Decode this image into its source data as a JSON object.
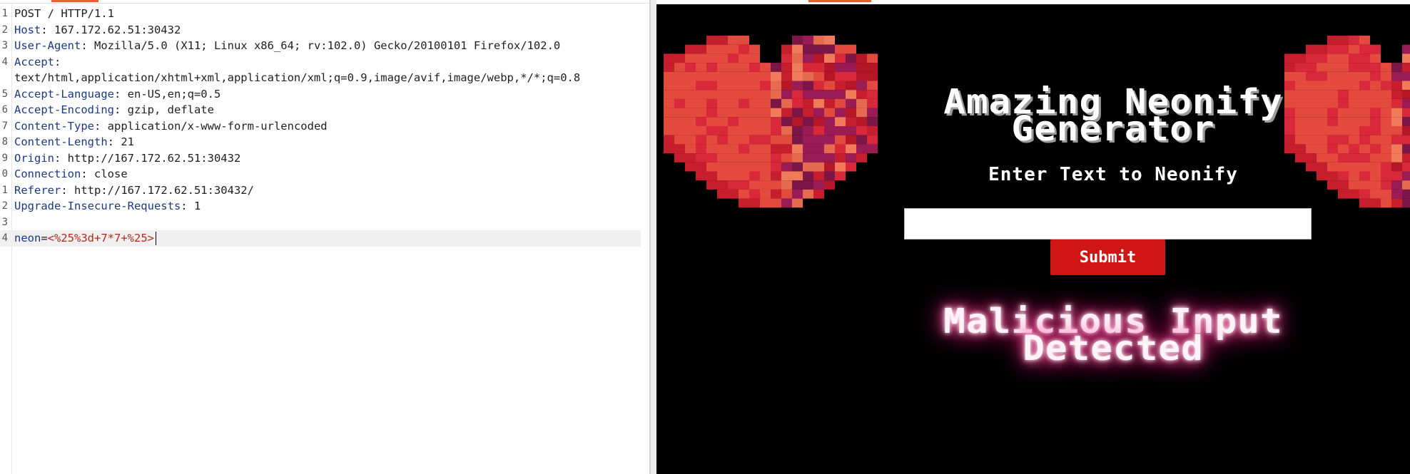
{
  "request": {
    "lines": [
      {
        "num": "1",
        "plain": "POST / HTTP/1.1"
      },
      {
        "num": "2",
        "name": "Host",
        "value": " 167.172.62.51:30432"
      },
      {
        "num": "3",
        "name": "User-Agent",
        "value": " Mozilla/5.0 (X11; Linux x86_64; rv:102.0) Gecko/20100101 Firefox/102.0"
      },
      {
        "num": "4",
        "name": "Accept",
        "value": ""
      },
      {
        "num": "",
        "plain": "text/html,application/xhtml+xml,application/xml;q=0.9,image/avif,image/webp,*/*;q=0.8"
      },
      {
        "num": "5",
        "name": "Accept-Language",
        "value": " en-US,en;q=0.5"
      },
      {
        "num": "6",
        "name": "Accept-Encoding",
        "value": " gzip, deflate"
      },
      {
        "num": "7",
        "name": "Content-Type",
        "value": " application/x-www-form-urlencoded"
      },
      {
        "num": "8",
        "name": "Content-Length",
        "value": " 21"
      },
      {
        "num": "9",
        "name": "Origin",
        "value": " http://167.172.62.51:30432"
      },
      {
        "num": "0",
        "name": "Connection",
        "value": " close"
      },
      {
        "num": "1",
        "name": "Referer",
        "value": " http://167.172.62.51:30432/"
      },
      {
        "num": "2",
        "name": "Upgrade-Insecure-Requests",
        "value": " 1"
      },
      {
        "num": "3",
        "plain": ""
      },
      {
        "num": "4",
        "param": "neon",
        "value": "<%25%3d+7*7+%25>",
        "active": true
      }
    ]
  },
  "response_page": {
    "title_line1": "Amazing Neonify",
    "title_line2": "Generator",
    "subtitle": "Enter Text to Neonify",
    "input_value": "",
    "submit_label": "Submit",
    "output_line1": "Malicious Input",
    "output_line2": "Detected"
  },
  "colors": {
    "accent": "#e8612c",
    "header_name": "#1a3a86",
    "param_value": "#b22a1d",
    "submit_bg": "#d01515",
    "neon_glow": "#ff2d8a"
  }
}
